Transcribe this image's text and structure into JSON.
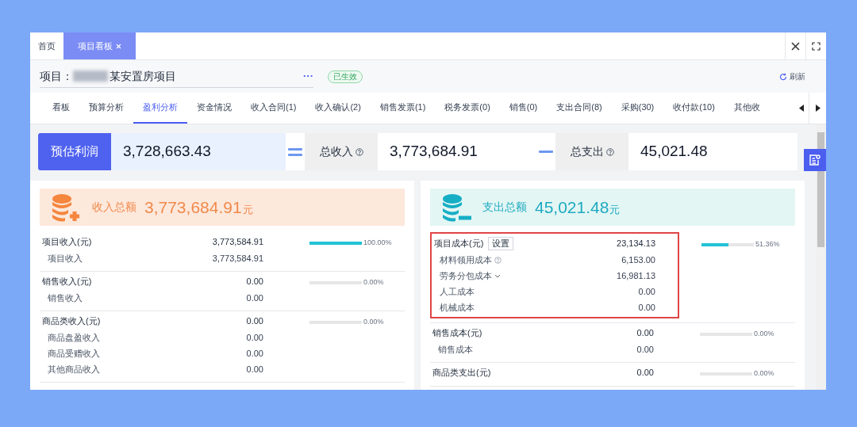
{
  "tabs": [
    {
      "label": "首页",
      "selected": false,
      "closable": false
    },
    {
      "label": "项目看板",
      "selected": true,
      "closable": true
    }
  ],
  "header": {
    "project_label": "项目：",
    "project_name": "某安置房项目",
    "more": "···",
    "status": "已生效",
    "refresh": "刷新"
  },
  "nav_tabs": [
    {
      "label": "看板",
      "selected": false
    },
    {
      "label": "预算分析",
      "selected": false
    },
    {
      "label": "盈利分析",
      "selected": true
    },
    {
      "label": "资金情况",
      "selected": false
    },
    {
      "label": "收入合同(1)",
      "selected": false
    },
    {
      "label": "收入确认(2)",
      "selected": false
    },
    {
      "label": "销售发票(1)",
      "selected": false
    },
    {
      "label": "税务发票(0)",
      "selected": false
    },
    {
      "label": "销售(0)",
      "selected": false
    },
    {
      "label": "支出合同(8)",
      "selected": false
    },
    {
      "label": "采购(30)",
      "selected": false
    },
    {
      "label": "收付款(10)",
      "selected": false
    },
    {
      "label": "其他收",
      "selected": false
    }
  ],
  "summary": {
    "profit": {
      "label": "预估利润",
      "value": "3,728,663.43"
    },
    "income": {
      "label": "总收入",
      "value": "3,773,684.91"
    },
    "expense": {
      "label": "总支出",
      "value": "45,021.48"
    }
  },
  "panels": [
    {
      "kind": "income",
      "title": "收入总额",
      "total": "3,773,684.91",
      "unit": "元",
      "groups": [
        {
          "label": "项目收入(元)",
          "value": "3,773,584.91",
          "level": 1,
          "percent": "100.00%",
          "highlighted": false,
          "children": [
            {
              "label": "项目收入",
              "value": "3,773,584.91"
            }
          ]
        },
        {
          "label": "销售收入(元)",
          "value": "0.00",
          "level": 0,
          "percent": "0.00%",
          "highlighted": false,
          "children": [
            {
              "label": "销售收入",
              "value": "0.00"
            }
          ]
        },
        {
          "label": "商品类收入(元)",
          "value": "0.00",
          "level": 0,
          "percent": "0.00%",
          "highlighted": false,
          "children": [
            {
              "label": "商品盘盈收入",
              "value": "0.00"
            },
            {
              "label": "商品受赠收入",
              "value": "0.00"
            },
            {
              "label": "其他商品收入",
              "value": "0.00"
            }
          ]
        }
      ]
    },
    {
      "kind": "expense",
      "title": "支出总额",
      "total": "45,021.48",
      "unit": "元",
      "groups": [
        {
          "label": "项目成本(元)",
          "button": "设置",
          "value": "23,134.13",
          "level": 0.5136,
          "percent": "51.36%",
          "highlighted": true,
          "children": [
            {
              "label": "材料领用成本",
              "value": "6,153.00",
              "kind": "help"
            },
            {
              "label": "劳务分包成本",
              "value": "16,981.13",
              "kind": "dropdown"
            },
            {
              "label": "人工成本",
              "value": "0.00"
            },
            {
              "label": "机械成本",
              "value": "0.00"
            }
          ]
        },
        {
          "label": "销售成本(元)",
          "value": "0.00",
          "level": 0,
          "percent": "0.00%",
          "highlighted": false,
          "children": [
            {
              "label": "销售成本",
              "value": "0.00"
            }
          ]
        },
        {
          "label": "商品类支出(元)",
          "value": "0.00",
          "level": 0,
          "percent": "0.00%",
          "highlighted": false
        }
      ]
    }
  ]
}
